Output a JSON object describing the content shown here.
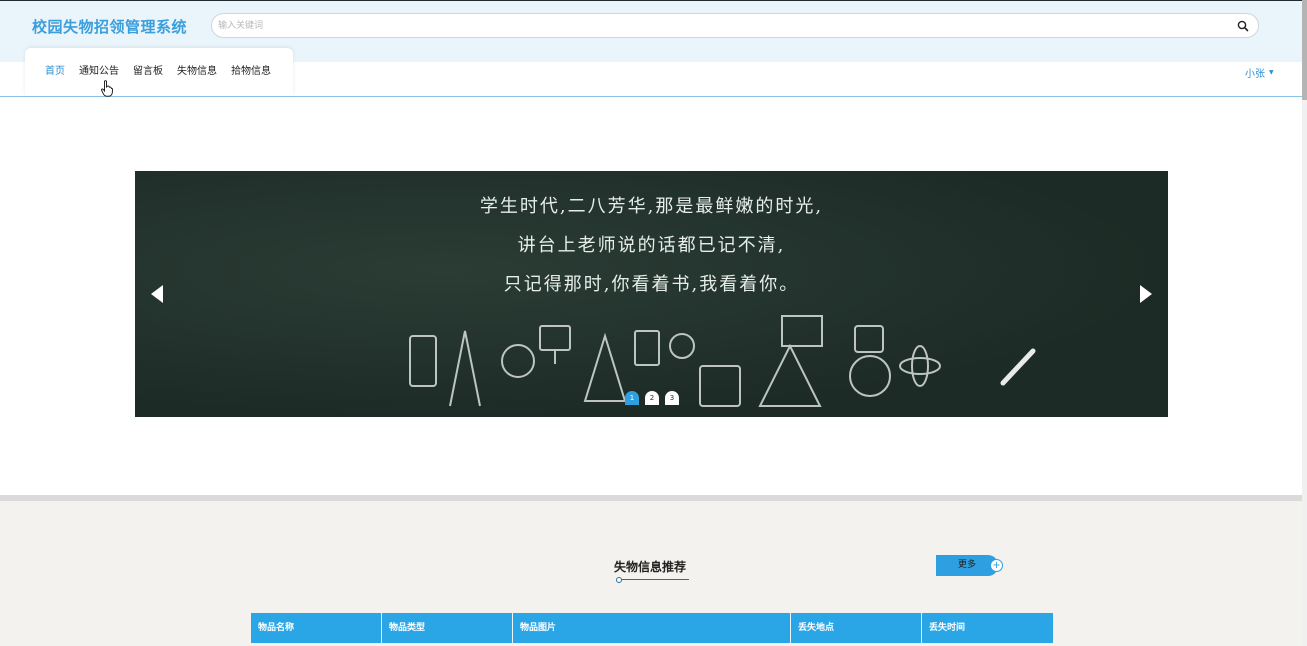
{
  "header": {
    "logo": "校园失物招领管理系统",
    "search_placeholder": "输入关键词"
  },
  "nav": {
    "items": [
      "首页",
      "通知公告",
      "留言板",
      "失物信息",
      "拾物信息"
    ],
    "active_index": 0,
    "user": "小张"
  },
  "carousel": {
    "lines": [
      "学生时代,二八芳华,那是最鲜嫩的时光,",
      "讲台上老师说的话都已记不清,",
      "只记得那时,你看着书,我看着你。"
    ],
    "pages": [
      "1",
      "2",
      "3"
    ],
    "active_page": 0
  },
  "section": {
    "title": "失物信息推荐",
    "more_label": "更多"
  },
  "table": {
    "headers": [
      "物品名称",
      "物品类型",
      "物品图片",
      "丢失地点",
      "丢失时间"
    ]
  },
  "colors": {
    "accent": "#2aa5e6",
    "logo": "#3b9fdc",
    "board": "#22322c"
  }
}
